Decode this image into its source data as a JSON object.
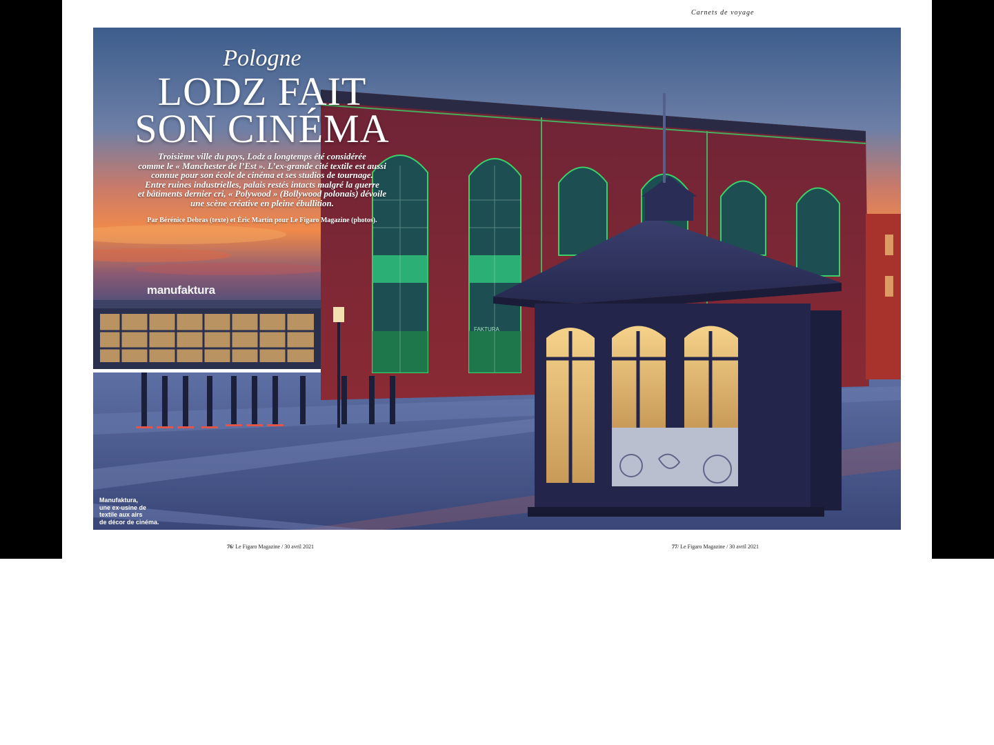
{
  "header": {
    "rubric": "Carnets de voyage"
  },
  "article": {
    "kicker": "Pologne",
    "headline": [
      "LODZ FAIT",
      "SON CINÉMA"
    ],
    "standfirst": [
      "Troisième ville du pays, Lodz a longtemps été considérée",
      "comme le « Manchester de l’Est ». L’ex-grande cité textile est aussi",
      "connue pour son école de cinéma et ses studios de tournage.",
      "Entre ruines industrielles, palais restés intacts malgré la guerre",
      "et bâtiments dernier cri, « Polywood » (Bollywood polonais) dévoile",
      "une scène créative en pleine ébullition."
    ],
    "byline": "Par Bérénice Debras (texte) et Éric Martin pour Le Figaro Magazine (photos).",
    "caption": [
      "Manufaktura,",
      "une ex-usine de",
      "textile aux airs",
      "de décor de cinéma."
    ]
  },
  "photo": {
    "sign_text": "manufaktura",
    "facade_sign": "FAKTURA",
    "colors": {
      "sky_top": "#3d5d8c",
      "sunset": "#f08a4a",
      "brick": "#7a1f2e",
      "neon_green": "#3bd16a",
      "plaza": "#4c5a8c",
      "kiosk_light": "#f3c77a"
    }
  },
  "footer": {
    "left": {
      "page": "76",
      "text": "/ Le Figaro Magazine / 30 avril 2021"
    },
    "right": {
      "page": "77",
      "text": "/ Le Figaro Magazine / 30 avril 2021"
    }
  }
}
